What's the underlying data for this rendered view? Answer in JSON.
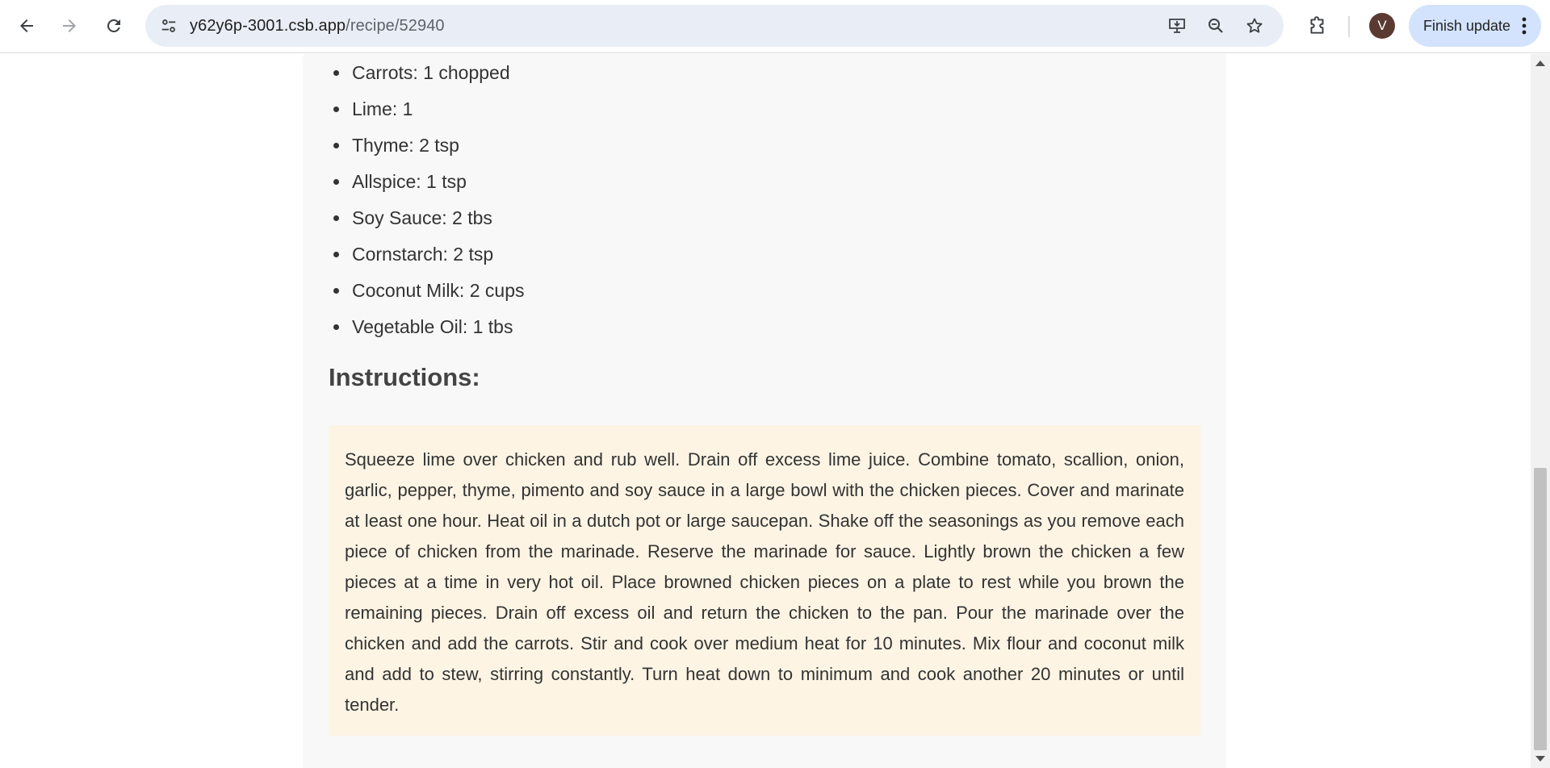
{
  "browser": {
    "url_host": "y62y6p-3001.csb.app",
    "url_path": "/recipe/52940",
    "profile_initial": "V",
    "update_label": "Finish update",
    "icons": {
      "back": "back-arrow-icon",
      "forward": "forward-arrow-icon",
      "reload": "reload-icon",
      "site_info": "tune-icon",
      "install": "install-app-icon",
      "zoom": "zoom-icon",
      "bookmark": "star-icon",
      "extensions": "puzzle-icon",
      "menu": "kebab-menu-icon"
    }
  },
  "recipe": {
    "ingredients": [
      "Carrots: 1 chopped",
      "Lime: 1",
      "Thyme: 2 tsp",
      "Allspice: 1 tsp",
      "Soy Sauce: 2 tbs",
      "Cornstarch: 2 tsp",
      "Coconut Milk: 2 cups",
      "Vegetable Oil: 1 tbs"
    ],
    "instructions_heading": "Instructions:",
    "instructions_text": "Squeeze lime over chicken and rub well. Drain off excess lime juice. Combine tomato, scallion, onion, garlic, pepper, thyme, pimento and soy sauce in a large bowl with the chicken pieces. Cover and marinate at least one hour. Heat oil in a dutch pot or large saucepan. Shake off the seasonings as you remove each piece of chicken from the marinade. Reserve the marinade for sauce. Lightly brown the chicken a few pieces at a time in very hot oil. Place browned chicken pieces on a plate to rest while you brown the remaining pieces. Drain off excess oil and return the chicken to the pan. Pour the marinade over the chicken and add the carrots. Stir and cook over medium heat for 10 minutes. Mix flour and coconut milk and add to stew, stirring constantly. Turn heat down to minimum and cook another 20 minutes or until tender."
  },
  "colors": {
    "card_bg": "#f8f8f8",
    "instructions_bg": "#fdf4e4",
    "update_btn_bg": "#d3e3fd",
    "avatar_bg": "#5a3a31"
  }
}
